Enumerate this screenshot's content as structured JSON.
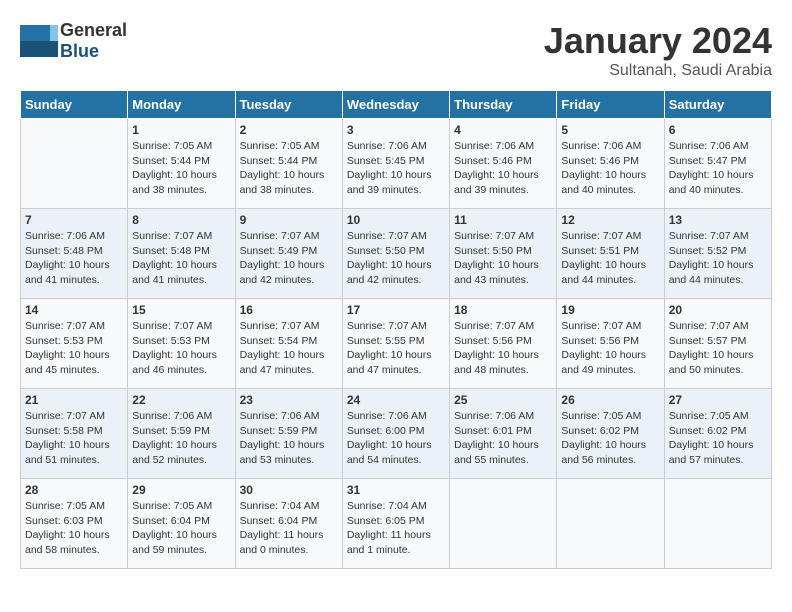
{
  "header": {
    "logo_general": "General",
    "logo_blue": "Blue",
    "month_year": "January 2024",
    "location": "Sultanah, Saudi Arabia"
  },
  "days_of_week": [
    "Sunday",
    "Monday",
    "Tuesday",
    "Wednesday",
    "Thursday",
    "Friday",
    "Saturday"
  ],
  "weeks": [
    [
      {
        "day": "",
        "sunrise": "",
        "sunset": "",
        "daylight": ""
      },
      {
        "day": "1",
        "sunrise": "Sunrise: 7:05 AM",
        "sunset": "Sunset: 5:44 PM",
        "daylight": "Daylight: 10 hours and 38 minutes."
      },
      {
        "day": "2",
        "sunrise": "Sunrise: 7:05 AM",
        "sunset": "Sunset: 5:44 PM",
        "daylight": "Daylight: 10 hours and 38 minutes."
      },
      {
        "day": "3",
        "sunrise": "Sunrise: 7:06 AM",
        "sunset": "Sunset: 5:45 PM",
        "daylight": "Daylight: 10 hours and 39 minutes."
      },
      {
        "day": "4",
        "sunrise": "Sunrise: 7:06 AM",
        "sunset": "Sunset: 5:46 PM",
        "daylight": "Daylight: 10 hours and 39 minutes."
      },
      {
        "day": "5",
        "sunrise": "Sunrise: 7:06 AM",
        "sunset": "Sunset: 5:46 PM",
        "daylight": "Daylight: 10 hours and 40 minutes."
      },
      {
        "day": "6",
        "sunrise": "Sunrise: 7:06 AM",
        "sunset": "Sunset: 5:47 PM",
        "daylight": "Daylight: 10 hours and 40 minutes."
      }
    ],
    [
      {
        "day": "7",
        "sunrise": "Sunrise: 7:06 AM",
        "sunset": "Sunset: 5:48 PM",
        "daylight": "Daylight: 10 hours and 41 minutes."
      },
      {
        "day": "8",
        "sunrise": "Sunrise: 7:07 AM",
        "sunset": "Sunset: 5:48 PM",
        "daylight": "Daylight: 10 hours and 41 minutes."
      },
      {
        "day": "9",
        "sunrise": "Sunrise: 7:07 AM",
        "sunset": "Sunset: 5:49 PM",
        "daylight": "Daylight: 10 hours and 42 minutes."
      },
      {
        "day": "10",
        "sunrise": "Sunrise: 7:07 AM",
        "sunset": "Sunset: 5:50 PM",
        "daylight": "Daylight: 10 hours and 42 minutes."
      },
      {
        "day": "11",
        "sunrise": "Sunrise: 7:07 AM",
        "sunset": "Sunset: 5:50 PM",
        "daylight": "Daylight: 10 hours and 43 minutes."
      },
      {
        "day": "12",
        "sunrise": "Sunrise: 7:07 AM",
        "sunset": "Sunset: 5:51 PM",
        "daylight": "Daylight: 10 hours and 44 minutes."
      },
      {
        "day": "13",
        "sunrise": "Sunrise: 7:07 AM",
        "sunset": "Sunset: 5:52 PM",
        "daylight": "Daylight: 10 hours and 44 minutes."
      }
    ],
    [
      {
        "day": "14",
        "sunrise": "Sunrise: 7:07 AM",
        "sunset": "Sunset: 5:53 PM",
        "daylight": "Daylight: 10 hours and 45 minutes."
      },
      {
        "day": "15",
        "sunrise": "Sunrise: 7:07 AM",
        "sunset": "Sunset: 5:53 PM",
        "daylight": "Daylight: 10 hours and 46 minutes."
      },
      {
        "day": "16",
        "sunrise": "Sunrise: 7:07 AM",
        "sunset": "Sunset: 5:54 PM",
        "daylight": "Daylight: 10 hours and 47 minutes."
      },
      {
        "day": "17",
        "sunrise": "Sunrise: 7:07 AM",
        "sunset": "Sunset: 5:55 PM",
        "daylight": "Daylight: 10 hours and 47 minutes."
      },
      {
        "day": "18",
        "sunrise": "Sunrise: 7:07 AM",
        "sunset": "Sunset: 5:56 PM",
        "daylight": "Daylight: 10 hours and 48 minutes."
      },
      {
        "day": "19",
        "sunrise": "Sunrise: 7:07 AM",
        "sunset": "Sunset: 5:56 PM",
        "daylight": "Daylight: 10 hours and 49 minutes."
      },
      {
        "day": "20",
        "sunrise": "Sunrise: 7:07 AM",
        "sunset": "Sunset: 5:57 PM",
        "daylight": "Daylight: 10 hours and 50 minutes."
      }
    ],
    [
      {
        "day": "21",
        "sunrise": "Sunrise: 7:07 AM",
        "sunset": "Sunset: 5:58 PM",
        "daylight": "Daylight: 10 hours and 51 minutes."
      },
      {
        "day": "22",
        "sunrise": "Sunrise: 7:06 AM",
        "sunset": "Sunset: 5:59 PM",
        "daylight": "Daylight: 10 hours and 52 minutes."
      },
      {
        "day": "23",
        "sunrise": "Sunrise: 7:06 AM",
        "sunset": "Sunset: 5:59 PM",
        "daylight": "Daylight: 10 hours and 53 minutes."
      },
      {
        "day": "24",
        "sunrise": "Sunrise: 7:06 AM",
        "sunset": "Sunset: 6:00 PM",
        "daylight": "Daylight: 10 hours and 54 minutes."
      },
      {
        "day": "25",
        "sunrise": "Sunrise: 7:06 AM",
        "sunset": "Sunset: 6:01 PM",
        "daylight": "Daylight: 10 hours and 55 minutes."
      },
      {
        "day": "26",
        "sunrise": "Sunrise: 7:05 AM",
        "sunset": "Sunset: 6:02 PM",
        "daylight": "Daylight: 10 hours and 56 minutes."
      },
      {
        "day": "27",
        "sunrise": "Sunrise: 7:05 AM",
        "sunset": "Sunset: 6:02 PM",
        "daylight": "Daylight: 10 hours and 57 minutes."
      }
    ],
    [
      {
        "day": "28",
        "sunrise": "Sunrise: 7:05 AM",
        "sunset": "Sunset: 6:03 PM",
        "daylight": "Daylight: 10 hours and 58 minutes."
      },
      {
        "day": "29",
        "sunrise": "Sunrise: 7:05 AM",
        "sunset": "Sunset: 6:04 PM",
        "daylight": "Daylight: 10 hours and 59 minutes."
      },
      {
        "day": "30",
        "sunrise": "Sunrise: 7:04 AM",
        "sunset": "Sunset: 6:04 PM",
        "daylight": "Daylight: 11 hours and 0 minutes."
      },
      {
        "day": "31",
        "sunrise": "Sunrise: 7:04 AM",
        "sunset": "Sunset: 6:05 PM",
        "daylight": "Daylight: 11 hours and 1 minute."
      },
      {
        "day": "",
        "sunrise": "",
        "sunset": "",
        "daylight": ""
      },
      {
        "day": "",
        "sunrise": "",
        "sunset": "",
        "daylight": ""
      },
      {
        "day": "",
        "sunrise": "",
        "sunset": "",
        "daylight": ""
      }
    ]
  ]
}
